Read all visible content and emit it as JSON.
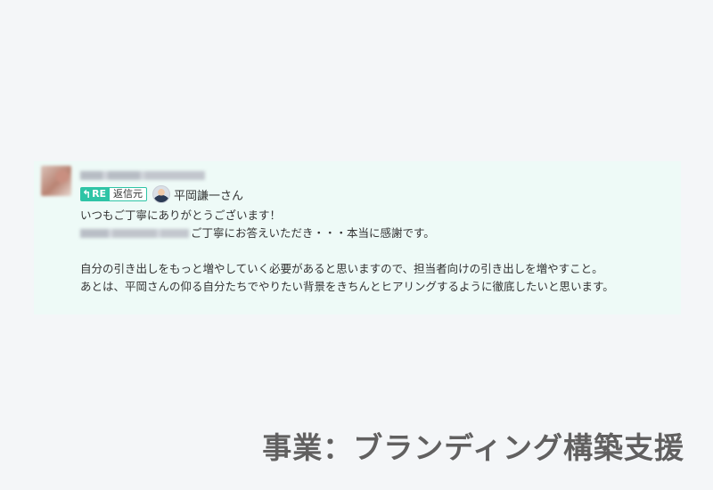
{
  "message": {
    "sender_name": "■■■■■■■■■■■",
    "reply_badge": {
      "arrow_icon": "reply-arrow-icon",
      "re_label": "RE",
      "source_label": "返信元"
    },
    "mention": {
      "name": "平岡謙一さん"
    },
    "lines": {
      "l1": "いつもご丁寧にありがとうございます！",
      "l2_redacted": "■■■■■■■■■■",
      "l2": "ご丁寧にお答えいただき・・・本当に感謝です。",
      "l3": "自分の引き出しをもっと増やしていく必要があると思いますので、担当者向けの引き出しを増やすこと。",
      "l4": "あとは、平岡さんの仰る自分たちでやりたい背景をきちんとヒアリングするように徹底したいと思います。"
    }
  },
  "caption": "事業：ブランディング構築支援",
  "colors": {
    "background": "#f4f6f8",
    "message_bg": "#eefaf7",
    "accent": "#2ec4a6",
    "caption": "#616060"
  }
}
